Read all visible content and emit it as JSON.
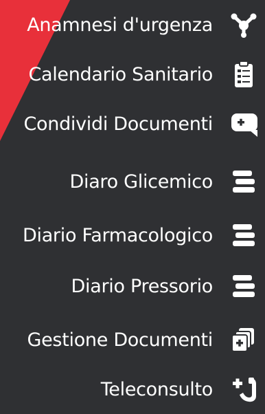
{
  "menu": {
    "items": [
      {
        "label": "Anamnesi d'urgenza",
        "icon": "network-share-icon"
      },
      {
        "label": "Calendario Sanitario",
        "icon": "clipboard-list-icon"
      },
      {
        "label": "Condividi Documenti",
        "icon": "medical-chat-icon"
      },
      {
        "label": "Diaro Glicemico",
        "icon": "stacked-bars-icon"
      },
      {
        "label": "Diario Farmacologico",
        "icon": "stacked-bars-icon"
      },
      {
        "label": "Diario Pressorio",
        "icon": "stacked-bars-icon"
      },
      {
        "label": "Gestione Documenti",
        "icon": "medical-documents-icon"
      },
      {
        "label": "Teleconsulto",
        "icon": "medical-phone-icon"
      }
    ]
  },
  "colors": {
    "background": "#2f3033",
    "accent": "#e8303a",
    "text": "#ffffff"
  }
}
